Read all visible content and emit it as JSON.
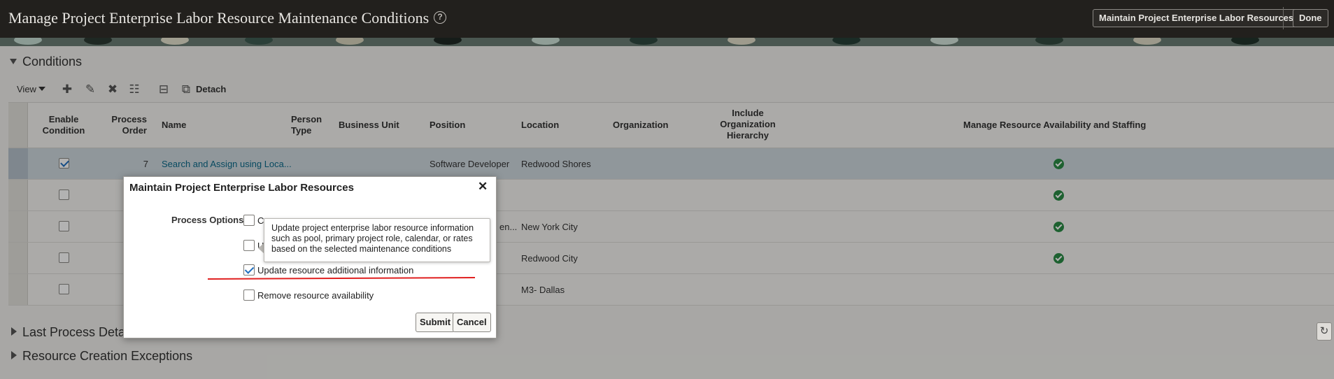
{
  "header": {
    "title": "Manage Project Enterprise Labor Resource Maintenance Conditions",
    "help_icon": "question-circle-icon",
    "maintain_button": "Maintain Project Enterprise Labor Resources",
    "done_button": "Done"
  },
  "conditions": {
    "section_title": "Conditions",
    "toolbar": {
      "view_label": "View",
      "add_icon": "plus-icon",
      "edit_icon": "pencil-icon",
      "delete_icon": "x-icon",
      "columns_icon": "column-settings-icon",
      "freeze_icon": "freeze-icon",
      "detach_icon": "detach-icon",
      "detach_label": "Detach"
    },
    "columns": {
      "enable_condition": "Enable Condition",
      "process_order": "Process Order",
      "name": "Name",
      "person_type": "Person Type",
      "business_unit": "Business Unit",
      "position": "Position",
      "location": "Location",
      "organization": "Organization",
      "include_org_hierarchy": "Include Organization Hierarchy",
      "manage_availability": "Manage Resource Availability and Staffing"
    },
    "rows": [
      {
        "enabled": true,
        "process_order": "7",
        "name": "Search and Assign using Loca...",
        "position": "Software Developer",
        "location": "Redwood Shores",
        "manage": true
      },
      {
        "enabled": false,
        "process_order": "",
        "name": "",
        "position": "",
        "location": "",
        "manage": true
      },
      {
        "enabled": false,
        "process_order": "",
        "name": "",
        "position": "en...",
        "location": "New York City",
        "manage": true
      },
      {
        "enabled": false,
        "process_order": "",
        "name": "",
        "position": "",
        "location": "Redwood City",
        "manage": true
      },
      {
        "enabled": false,
        "process_order": "",
        "name": "",
        "position": "",
        "location": "M3- Dallas",
        "manage": false
      }
    ]
  },
  "last_process": {
    "title": "Last Process Deta"
  },
  "exceptions": {
    "title": "Resource Creation Exceptions"
  },
  "refresh_icon": "refresh-icon",
  "dialog": {
    "title": "Maintain Project Enterprise Labor Resources",
    "close_icon": "close-icon",
    "process_options_label": "Process Options",
    "options": [
      {
        "label": "Cr",
        "checked": false
      },
      {
        "label": "U",
        "checked": false
      },
      {
        "label": "Update resource additional information",
        "checked": true
      },
      {
        "label": "Remove resource availability",
        "checked": false
      }
    ],
    "tooltip": "Update project enterprise labor resource information such as pool, primary project role, calendar, or rates based on the selected maintenance conditions",
    "submit_button": "Submit",
    "cancel_button": "Cancel"
  },
  "colors": {
    "header_bg": "#22201d",
    "link": "#0b6a8a",
    "success": "#2a8b45",
    "annotation_line": "#e02020"
  }
}
